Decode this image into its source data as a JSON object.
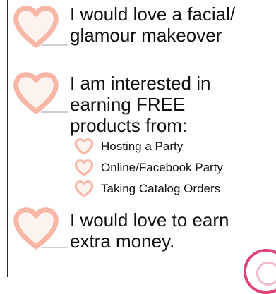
{
  "options": [
    {
      "lines": [
        "I would love a facial/",
        "glamour makeover"
      ]
    },
    {
      "lines": [
        "I am interested in",
        "earning FREE",
        "products from:"
      ],
      "sub_items": [
        "Hosting a Party",
        "Online/Facebook Party",
        "Taking Catalog Orders"
      ]
    },
    {
      "lines": [
        "I would love to earn",
        "extra money."
      ]
    }
  ],
  "colors": {
    "heart_outline": "#f7b6a6",
    "heart_fill": "#fdf3ee",
    "accent": "#e0427a"
  },
  "icons": {
    "checkbox": "heart-icon"
  }
}
